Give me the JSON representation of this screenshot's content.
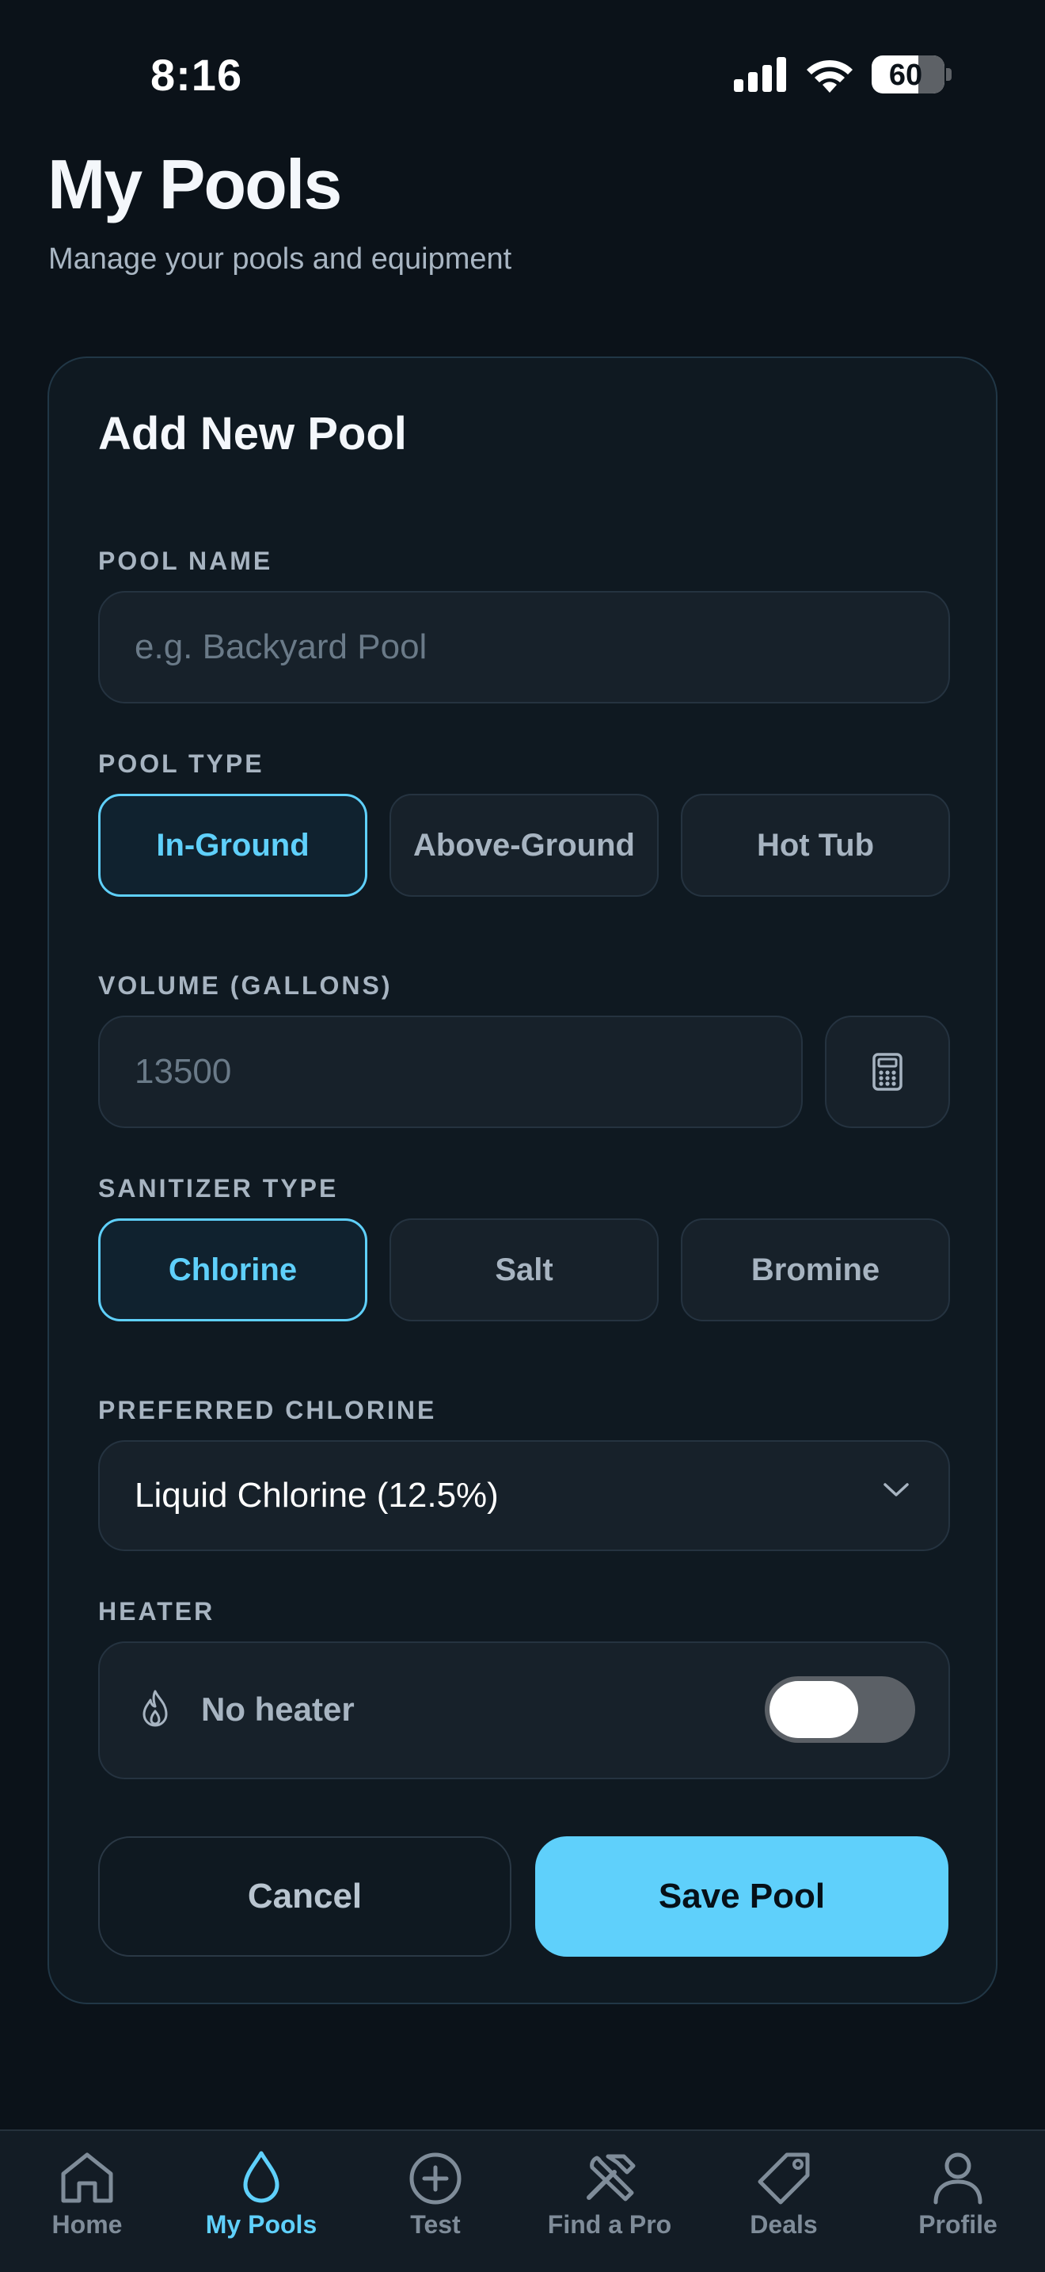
{
  "status_bar": {
    "time": "8:16",
    "battery": "60"
  },
  "header": {
    "title": "My Pools",
    "subtitle": "Manage your pools and equipment"
  },
  "form": {
    "title": "Add New Pool",
    "pool_name": {
      "label": "POOL NAME",
      "placeholder": "e.g. Backyard Pool"
    },
    "pool_type": {
      "label": "POOL TYPE",
      "options": [
        "In-Ground",
        "Above-Ground",
        "Hot Tub"
      ],
      "selected": "In-Ground"
    },
    "volume": {
      "label": "VOLUME (GALLONS)",
      "placeholder": "13500",
      "calculator_icon": "calculator-icon"
    },
    "sanitizer": {
      "label": "SANITIZER TYPE",
      "options": [
        "Chlorine",
        "Salt",
        "Bromine"
      ],
      "selected": "Chlorine"
    },
    "preferred_chlorine": {
      "label": "PREFERRED CHLORINE",
      "value": "Liquid Chlorine (12.5%)"
    },
    "heater": {
      "label": "HEATER",
      "value": "No heater",
      "icon": "flame-icon",
      "toggle_on": false
    },
    "cancel_label": "Cancel",
    "save_label": "Save Pool"
  },
  "tabbar": {
    "items": [
      {
        "label": "Home",
        "icon": "home-icon"
      },
      {
        "label": "My Pools",
        "icon": "droplet-icon"
      },
      {
        "label": "Test",
        "icon": "plus-circle-icon"
      },
      {
        "label": "Find a Pro",
        "icon": "tools-icon"
      },
      {
        "label": "Deals",
        "icon": "tag-icon"
      },
      {
        "label": "Profile",
        "icon": "person-icon"
      }
    ],
    "active": "My Pools"
  },
  "colors": {
    "background": "#0b1219",
    "card": "#0f1921",
    "accent": "#5fd0fb",
    "muted_text": "#a7b4c1"
  }
}
